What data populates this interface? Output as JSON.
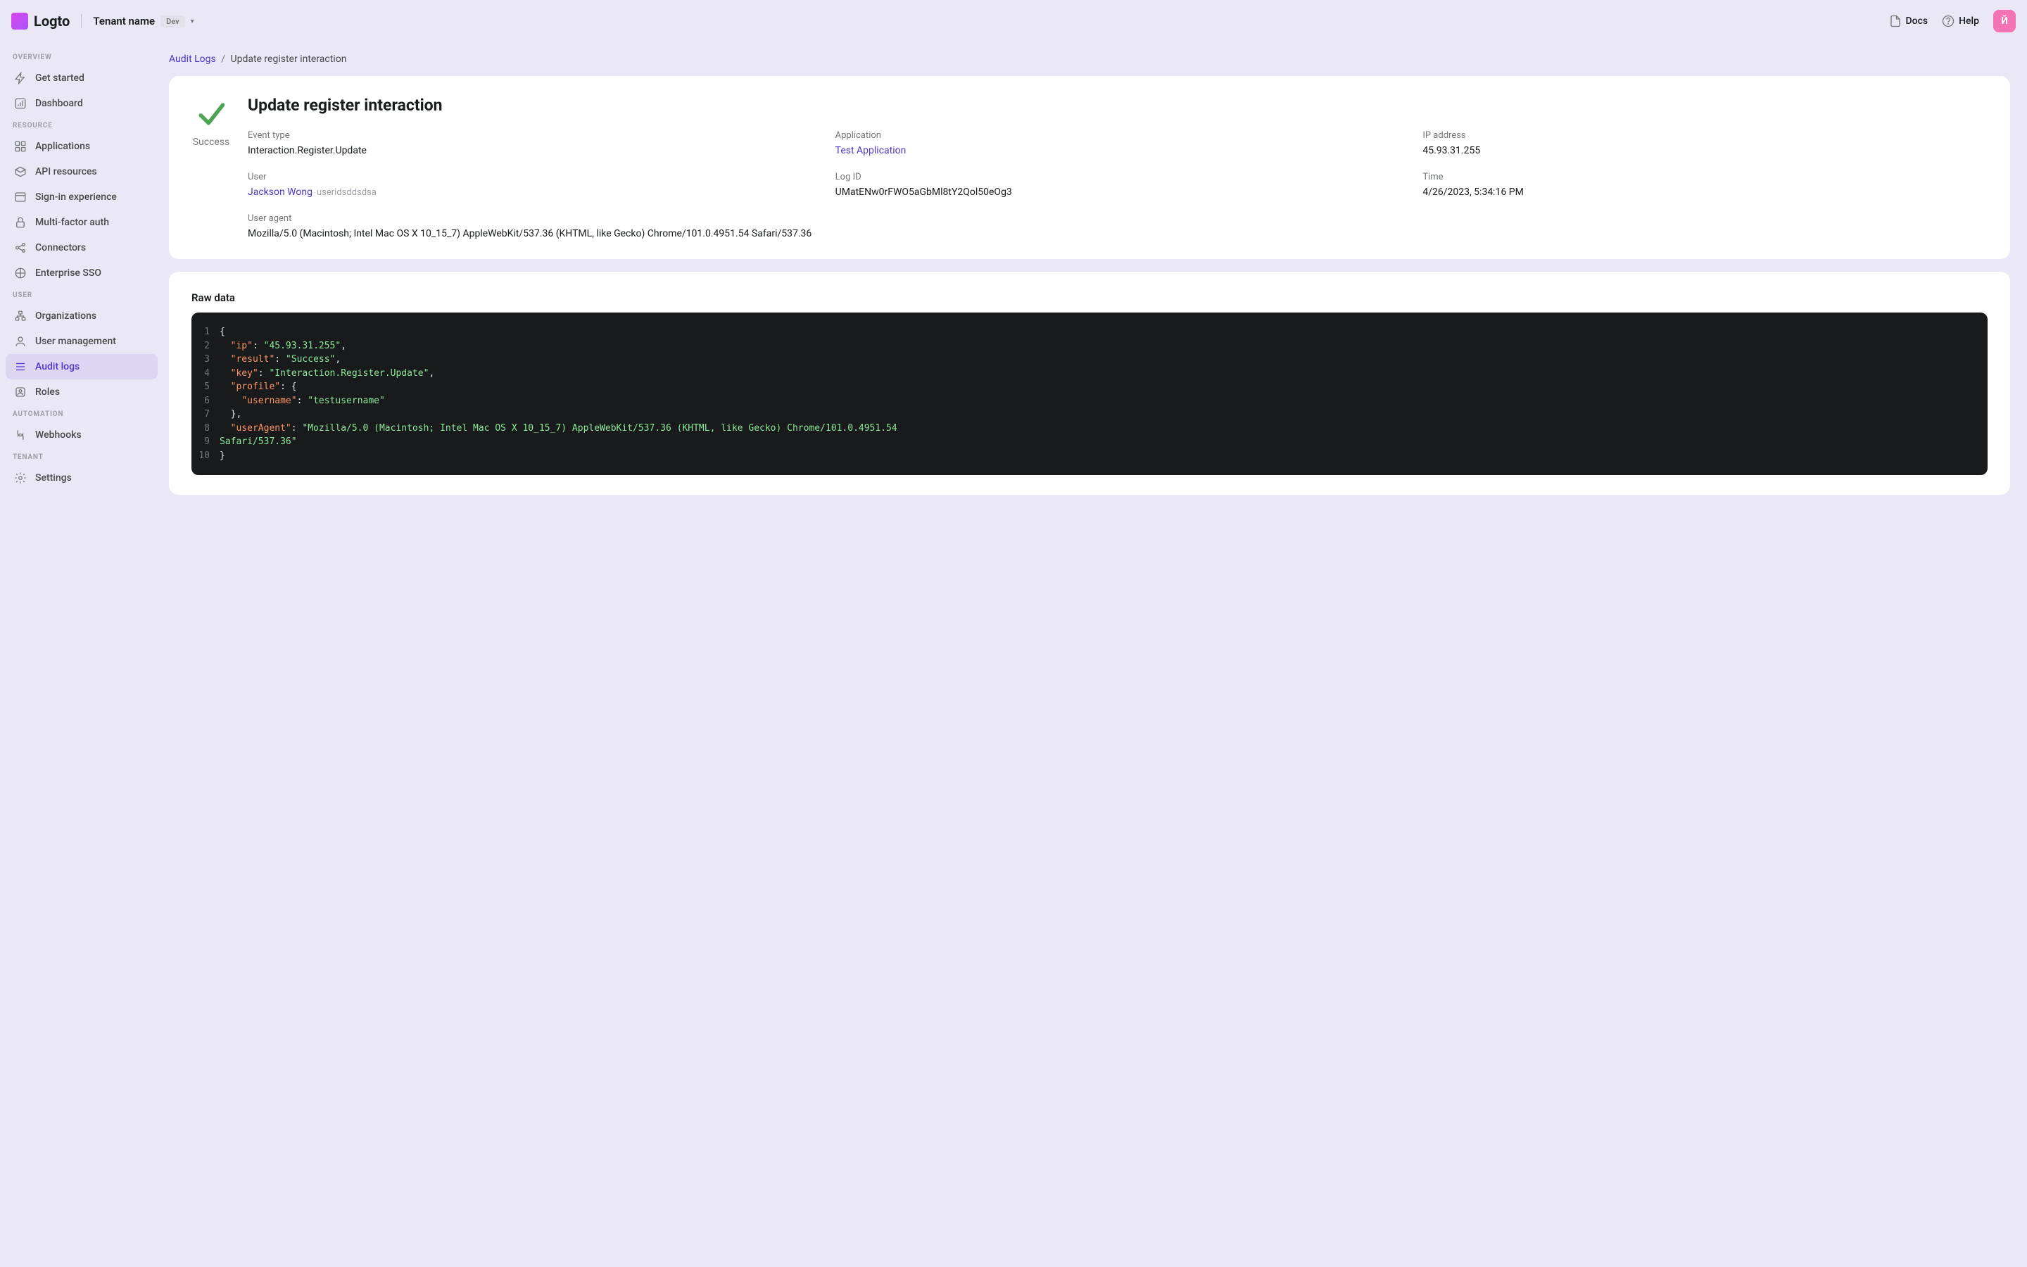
{
  "header": {
    "brand": "Logto",
    "tenant_name": "Tenant name",
    "tenant_badge": "Dev",
    "docs": "Docs",
    "help": "Help",
    "avatar": "Й"
  },
  "sidebar": {
    "sections": [
      {
        "title": "OVERVIEW",
        "items": [
          {
            "label": "Get started",
            "icon": "zap"
          },
          {
            "label": "Dashboard",
            "icon": "chart"
          }
        ]
      },
      {
        "title": "RESOURCE",
        "items": [
          {
            "label": "Applications",
            "icon": "grid"
          },
          {
            "label": "API resources",
            "icon": "box"
          },
          {
            "label": "Sign-in experience",
            "icon": "window"
          },
          {
            "label": "Multi-factor auth",
            "icon": "lock"
          },
          {
            "label": "Connectors",
            "icon": "share"
          },
          {
            "label": "Enterprise SSO",
            "icon": "sso"
          }
        ]
      },
      {
        "title": "USER",
        "items": [
          {
            "label": "Organizations",
            "icon": "org"
          },
          {
            "label": "User management",
            "icon": "user"
          },
          {
            "label": "Audit logs",
            "icon": "list",
            "active": true
          },
          {
            "label": "Roles",
            "icon": "role"
          }
        ]
      },
      {
        "title": "AUTOMATION",
        "items": [
          {
            "label": "Webhooks",
            "icon": "hook"
          }
        ]
      },
      {
        "title": "TENANT",
        "items": [
          {
            "label": "Settings",
            "icon": "gear"
          }
        ]
      }
    ]
  },
  "crumbs": {
    "parent": "Audit Logs",
    "current": "Update register interaction"
  },
  "detail": {
    "title": "Update register interaction",
    "status": "Success",
    "fields": {
      "event_type_lbl": "Event type",
      "event_type": "Interaction.Register.Update",
      "application_lbl": "Application",
      "application": "Test Application",
      "ip_lbl": "IP address",
      "ip": "45.93.31.255",
      "user_lbl": "User",
      "user_name": "Jackson Wong",
      "user_id": "useridsddsdsa",
      "logid_lbl": "Log ID",
      "logid": "UMatENw0rFWO5aGbMl8tY2Qol50eOg3",
      "time_lbl": "Time",
      "time": "4/26/2023, 5:34:16 PM",
      "ua_lbl": "User agent",
      "ua": "Mozilla/5.0 (Macintosh; Intel Mac OS X 10_15_7) AppleWebKit/537.36 (KHTML, like Gecko) Chrome/101.0.4951.54 Safari/537.36"
    }
  },
  "raw": {
    "title": "Raw data",
    "json": {
      "ip": "45.93.31.255",
      "result": "Success",
      "key": "Interaction.Register.Update",
      "profile": {
        "username": "testusername"
      },
      "userAgent": "Mozilla/5.0 (Macintosh; Intel Mac OS X 10_15_7) AppleWebKit/537.36 (KHTML, like Gecko) Chrome/101.0.4951.54 Safari/537.36"
    }
  }
}
